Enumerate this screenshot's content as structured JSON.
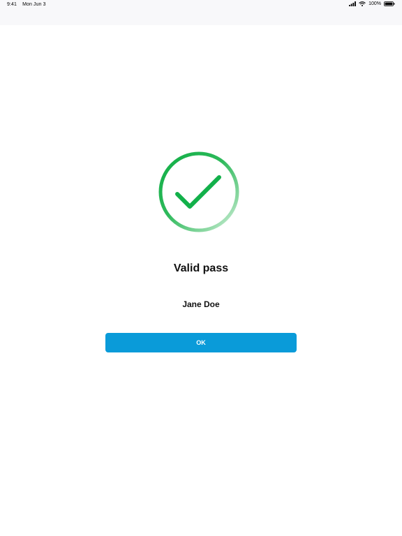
{
  "status_bar": {
    "time": "9:41",
    "date": "Mon Jun 3",
    "battery": "100%"
  },
  "result": {
    "title": "Valid pass",
    "name": "Jane Doe"
  },
  "actions": {
    "ok_label": "OK"
  },
  "colors": {
    "success_green": "#12b04a",
    "button_blue": "#0a9bd9"
  },
  "icons": {
    "status": "check-circle-icon"
  }
}
